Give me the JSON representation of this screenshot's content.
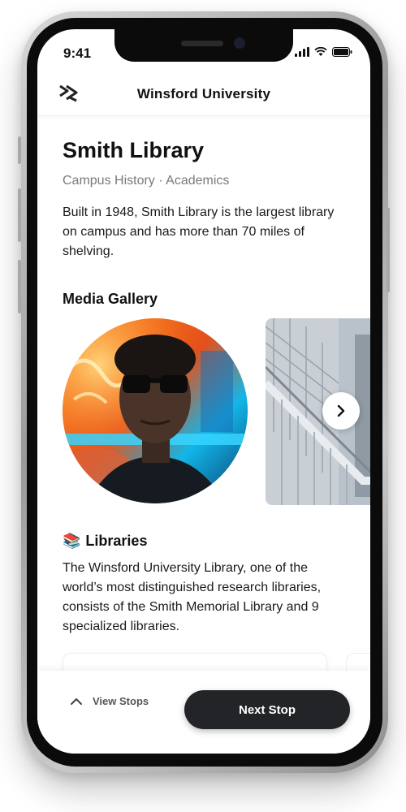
{
  "status_bar": {
    "time": "9:41",
    "icons": [
      "signal-icon",
      "wifi-icon",
      "battery-icon"
    ]
  },
  "header": {
    "logo_icon": "university-logo-icon",
    "title": "Winsford University"
  },
  "place": {
    "title": "Smith Library",
    "subtitle": "Campus History · Academics",
    "description": "Built in 1948, Smith Library is the largest library on campus and has more than 70 miles of shelving."
  },
  "media_gallery": {
    "title": "Media Gallery",
    "items": [
      {
        "kind": "portrait photo"
      },
      {
        "kind": "staircase photo"
      }
    ],
    "next_icon": "chevron-right-icon"
  },
  "libraries": {
    "emoji": "📚",
    "title": "Libraries",
    "description": "The Winsford University Library, one of the world’s most distinguished research libraries, consists of the Smith Memorial Library and 9 specialized libraries."
  },
  "bottom_bar": {
    "view_stops_label": "View Stops",
    "next_stop_label": "Next Stop"
  }
}
